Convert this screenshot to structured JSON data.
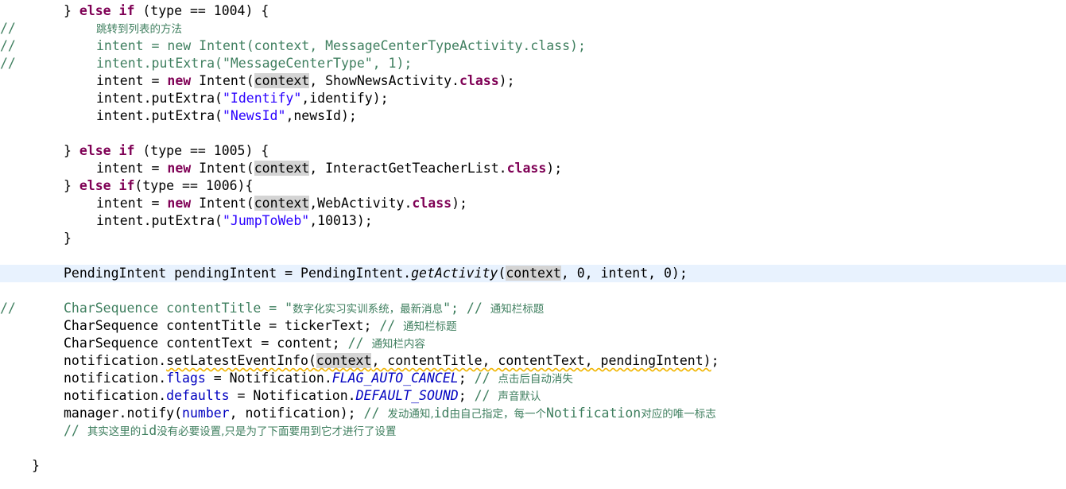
{
  "editor": {
    "lines": [
      {
        "gutter": "",
        "indent": 1,
        "tokens": [
          {
            "t": "} ",
            "c": ""
          },
          {
            "t": "else if",
            "c": "kw"
          },
          {
            "t": " (type == 1004) {",
            "c": ""
          }
        ]
      },
      {
        "gutter": "//",
        "indent": 2,
        "tokens": [
          {
            "t": "跳转到列表的方法",
            "c": "cm cm-zh"
          }
        ]
      },
      {
        "gutter": "//",
        "indent": 2,
        "tokens": [
          {
            "t": "intent = new Intent(context, MessageCenterTypeActivity.class);",
            "c": "cm"
          }
        ]
      },
      {
        "gutter": "//",
        "indent": 2,
        "tokens": [
          {
            "t": "intent.putExtra(\"MessageCenterType\", 1);",
            "c": "cm"
          }
        ]
      },
      {
        "gutter": "",
        "indent": 2,
        "tokens": [
          {
            "t": "intent = ",
            "c": ""
          },
          {
            "t": "new",
            "c": "kw"
          },
          {
            "t": " Intent(",
            "c": ""
          },
          {
            "t": "context",
            "c": "hl"
          },
          {
            "t": ", ShowNewsActivity.",
            "c": ""
          },
          {
            "t": "class",
            "c": "kw"
          },
          {
            "t": ");",
            "c": ""
          }
        ]
      },
      {
        "gutter": "",
        "indent": 2,
        "tokens": [
          {
            "t": "intent.putExtra(",
            "c": ""
          },
          {
            "t": "\"Identify\"",
            "c": "str"
          },
          {
            "t": ",identify);",
            "c": ""
          }
        ]
      },
      {
        "gutter": "",
        "indent": 2,
        "tokens": [
          {
            "t": "intent.putExtra(",
            "c": ""
          },
          {
            "t": "\"NewsId\"",
            "c": "str"
          },
          {
            "t": ",newsId);",
            "c": ""
          }
        ]
      },
      {
        "gutter": "",
        "indent": 2,
        "tokens": []
      },
      {
        "gutter": "",
        "indent": 1,
        "tokens": [
          {
            "t": "} ",
            "c": ""
          },
          {
            "t": "else if",
            "c": "kw"
          },
          {
            "t": " (type == 1005) {",
            "c": ""
          }
        ]
      },
      {
        "gutter": "",
        "indent": 2,
        "tokens": [
          {
            "t": "intent = ",
            "c": ""
          },
          {
            "t": "new",
            "c": "kw"
          },
          {
            "t": " Intent(",
            "c": ""
          },
          {
            "t": "context",
            "c": "hl"
          },
          {
            "t": ", InteractGetTeacherList.",
            "c": ""
          },
          {
            "t": "class",
            "c": "kw"
          },
          {
            "t": ");",
            "c": ""
          }
        ]
      },
      {
        "gutter": "",
        "indent": 1,
        "tokens": [
          {
            "t": "} ",
            "c": ""
          },
          {
            "t": "else if",
            "c": "kw"
          },
          {
            "t": "(type == 1006){",
            "c": ""
          }
        ]
      },
      {
        "gutter": "",
        "indent": 2,
        "tokens": [
          {
            "t": "intent = ",
            "c": ""
          },
          {
            "t": "new",
            "c": "kw"
          },
          {
            "t": " Intent(",
            "c": ""
          },
          {
            "t": "context",
            "c": "hl"
          },
          {
            "t": ",WebActivity.",
            "c": ""
          },
          {
            "t": "class",
            "c": "kw"
          },
          {
            "t": ");",
            "c": ""
          }
        ]
      },
      {
        "gutter": "",
        "indent": 2,
        "tokens": [
          {
            "t": "intent.putExtra(",
            "c": ""
          },
          {
            "t": "\"JumpToWeb\"",
            "c": "str"
          },
          {
            "t": ",10013);",
            "c": ""
          }
        ]
      },
      {
        "gutter": "",
        "indent": 1,
        "tokens": [
          {
            "t": "}",
            "c": ""
          }
        ]
      },
      {
        "gutter": "",
        "indent": 1,
        "tokens": []
      },
      {
        "gutter": "",
        "indent": 1,
        "current": true,
        "tokens": [
          {
            "t": "PendingIntent pendingIntent = PendingIntent.",
            "c": ""
          },
          {
            "t": "getActivity",
            "c": "it"
          },
          {
            "t": "(",
            "c": ""
          },
          {
            "t": "c",
            "c": "hl"
          },
          {
            "t": "",
            "c": "caret"
          },
          {
            "t": "ontext",
            "c": "hl"
          },
          {
            "t": ", 0, intent, 0);",
            "c": ""
          }
        ]
      },
      {
        "gutter": "",
        "indent": 1,
        "tokens": []
      },
      {
        "gutter": "//",
        "indent": 1,
        "tokens": [
          {
            "t": "CharSequence contentTitle = \"",
            "c": "cm"
          },
          {
            "t": "数字化实习实训系统，最新消息",
            "c": "cm cm-zh"
          },
          {
            "t": "\"; // ",
            "c": "cm"
          },
          {
            "t": "通知栏标题",
            "c": "cm cm-zh"
          }
        ]
      },
      {
        "gutter": "",
        "indent": 1,
        "tokens": [
          {
            "t": "CharSequence contentTitle = tickerText; ",
            "c": ""
          },
          {
            "t": "// ",
            "c": "cm"
          },
          {
            "t": "通知栏标题",
            "c": "cm cm-zh"
          }
        ]
      },
      {
        "gutter": "",
        "indent": 1,
        "tokens": [
          {
            "t": "CharSequence contentText = content; ",
            "c": ""
          },
          {
            "t": "// ",
            "c": "cm"
          },
          {
            "t": "通知栏内容",
            "c": "cm cm-zh"
          }
        ]
      },
      {
        "gutter": "",
        "indent": 1,
        "tokens": [
          {
            "t": "notification.",
            "c": ""
          },
          {
            "t": "setLatestEventInfo",
            "c": "dep warn"
          },
          {
            "t": "(",
            "c": "warn"
          },
          {
            "t": "context",
            "c": "hl warn"
          },
          {
            "t": ", contentTitle, contentText, pendingIntent)",
            "c": "warn"
          },
          {
            "t": ";",
            "c": ""
          }
        ]
      },
      {
        "gutter": "",
        "indent": 1,
        "tokens": [
          {
            "t": "notification.",
            "c": ""
          },
          {
            "t": "flags",
            "c": "fld"
          },
          {
            "t": " = Notification.",
            "c": ""
          },
          {
            "t": "FLAG_AUTO_CANCEL",
            "c": "cst"
          },
          {
            "t": "; ",
            "c": ""
          },
          {
            "t": "// ",
            "c": "cm"
          },
          {
            "t": "点击后自动消失",
            "c": "cm cm-zh"
          }
        ]
      },
      {
        "gutter": "",
        "indent": 1,
        "tokens": [
          {
            "t": "notification.",
            "c": ""
          },
          {
            "t": "defaults",
            "c": "fld"
          },
          {
            "t": " = Notification.",
            "c": ""
          },
          {
            "t": "DEFAULT_SOUND",
            "c": "cst"
          },
          {
            "t": "; ",
            "c": ""
          },
          {
            "t": "// ",
            "c": "cm"
          },
          {
            "t": "声音默认",
            "c": "cm cm-zh"
          }
        ]
      },
      {
        "gutter": "",
        "indent": 1,
        "tokens": [
          {
            "t": "manager.notify(",
            "c": ""
          },
          {
            "t": "number",
            "c": "fld"
          },
          {
            "t": ", notification); ",
            "c": ""
          },
          {
            "t": "// ",
            "c": "cm"
          },
          {
            "t": "发动通知,",
            "c": "cm cm-zh"
          },
          {
            "t": "id",
            "c": "cm"
          },
          {
            "t": "由自己指定，每一个",
            "c": "cm cm-zh"
          },
          {
            "t": "Notification",
            "c": "cm"
          },
          {
            "t": "对应的唯一标志",
            "c": "cm cm-zh"
          }
        ]
      },
      {
        "gutter": "",
        "indent": 1,
        "tokens": [
          {
            "t": "// ",
            "c": "cm"
          },
          {
            "t": "其实这里的",
            "c": "cm cm-zh"
          },
          {
            "t": "id",
            "c": "cm"
          },
          {
            "t": "没有必要设置,只是为了下面要用到它才进行了设置",
            "c": "cm cm-zh"
          }
        ]
      },
      {
        "gutter": "",
        "indent": 1,
        "tokens": []
      },
      {
        "gutter": "",
        "indent": 0,
        "tokens": [
          {
            "t": "}",
            "c": ""
          }
        ]
      }
    ]
  }
}
